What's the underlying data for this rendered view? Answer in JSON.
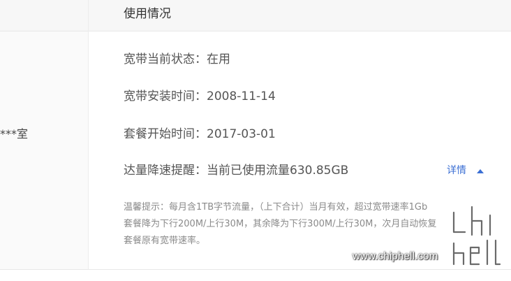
{
  "section": {
    "title": "使用情况"
  },
  "address": {
    "text": "***室"
  },
  "rows": {
    "status": {
      "label": "宽带当前状态：",
      "value": "在用"
    },
    "install": {
      "label": "宽带安装时间：",
      "value": "2008-11-14"
    },
    "package": {
      "label": "套餐开始时间：",
      "value": "2017-03-01"
    },
    "alert": {
      "label": "达量降速提醒：",
      "value": "当前已使用流量630.85GB"
    }
  },
  "details": {
    "label": "详情",
    "icon": "caret-up-icon"
  },
  "notice": {
    "line1": "温馨提示：每月含1TB字节流量，（上下合计）当月有效，超过宽带速率1Gb",
    "line2": "套餐降为下行200M/上行30M，其余降为下行300M/上行30M，次月自动恢复",
    "line3": "套餐原有宽带速率。"
  },
  "watermark": {
    "text": "www.chiphell.com"
  },
  "colors": {
    "link": "#3b6fd4",
    "text": "#555555",
    "notice": "#8a8a8a",
    "header_bg": "#f7f7f7"
  }
}
